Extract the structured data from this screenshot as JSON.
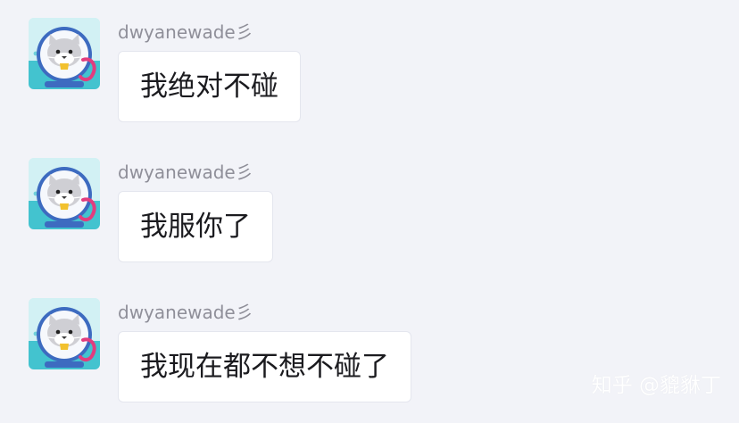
{
  "messages": [
    {
      "sender": "dwyanewade彡",
      "text": "我绝对不碰",
      "avatar": "otter-avatar"
    },
    {
      "sender": "dwyanewade彡",
      "text": "我服你了",
      "avatar": "otter-avatar"
    },
    {
      "sender": "dwyanewade彡",
      "text": "我现在都不想不碰了",
      "avatar": "otter-avatar"
    }
  ],
  "watermark": "知乎 @貔貅丁",
  "colors": {
    "background": "#f2f3f8",
    "bubble": "#ffffff",
    "sender_text": "#8f8f99",
    "message_text": "#1b1b1f"
  }
}
